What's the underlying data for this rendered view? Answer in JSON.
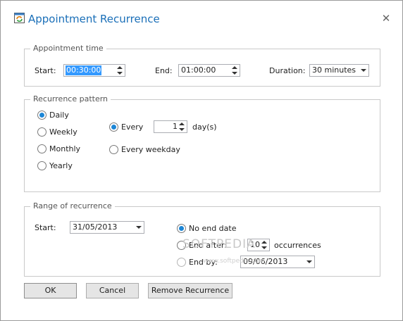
{
  "window": {
    "title": "Appointment Recurrence",
    "close_glyph": "✕"
  },
  "appointment_time": {
    "legend": "Appointment time",
    "start_label": "Start:",
    "start_value": "00:30:00",
    "end_label": "End:",
    "end_value": "01:00:00",
    "duration_label": "Duration:",
    "duration_value": "30 minutes"
  },
  "recurrence_pattern": {
    "legend": "Recurrence pattern",
    "options": [
      "Daily",
      "Weekly",
      "Monthly",
      "Yearly"
    ],
    "selected": "Daily",
    "every_label": "Every",
    "every_value": "1",
    "every_unit": "day(s)",
    "every_weekday_label": "Every weekday"
  },
  "range": {
    "legend": "Range of recurrence",
    "start_label": "Start:",
    "start_value": "31/05/2013",
    "no_end_label": "No end date",
    "end_after_label": "End after:",
    "end_after_value": "10",
    "occurrences_label": "occurrences",
    "end_by_label": "End by:",
    "end_by_value": "09/06/2013",
    "selected": "No end date"
  },
  "buttons": {
    "ok": "OK",
    "cancel": "Cancel",
    "remove": "Remove Recurrence"
  },
  "watermark": {
    "text": "SOFTPEDIA",
    "sub": "www.softpedia.com"
  },
  "colors": {
    "title": "#1a6fb8",
    "radio_selected": "#1c86d6",
    "selection": "#3399ff"
  }
}
